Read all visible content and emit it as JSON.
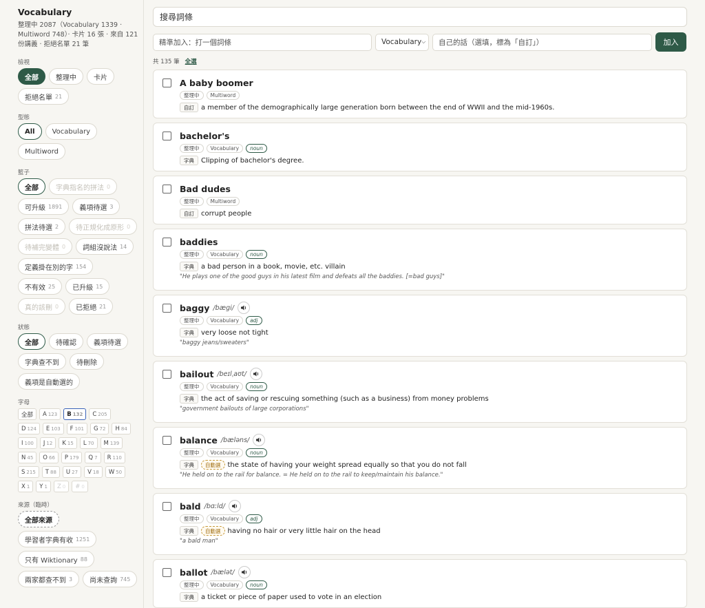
{
  "sidebar": {
    "title": "Vocabulary",
    "summary": "整理中 2087（Vocabulary 1339 · Multiword 748）· 卡片 16 張 · 來自 121 份講義 · 拒絕名單 21 筆",
    "view": {
      "label": "檢視",
      "options": [
        {
          "label": "全部",
          "count": "",
          "state": "active"
        },
        {
          "label": "整理中",
          "count": "",
          "state": ""
        },
        {
          "label": "卡片",
          "count": "",
          "state": ""
        },
        {
          "label": "拒絕名單",
          "count": "21",
          "state": ""
        }
      ]
    },
    "type": {
      "label": "型態",
      "options": [
        {
          "label": "All",
          "count": "",
          "state": "outline-active"
        },
        {
          "label": "Vocabulary",
          "count": "",
          "state": ""
        },
        {
          "label": "Multiword",
          "count": "",
          "state": ""
        }
      ]
    },
    "basket": {
      "label": "籃子",
      "options": [
        {
          "label": "全部",
          "count": "",
          "state": "outline-active"
        },
        {
          "label": "字典指名的拼法",
          "count": "0",
          "state": "disabled"
        },
        {
          "label": "可升級",
          "count": "1891",
          "state": ""
        },
        {
          "label": "義項待選",
          "count": "3",
          "state": ""
        },
        {
          "label": "拼法待選",
          "count": "2",
          "state": ""
        },
        {
          "label": "待正規化成原形",
          "count": "0",
          "state": "disabled"
        },
        {
          "label": "待補完變體",
          "count": "0",
          "state": "disabled"
        },
        {
          "label": "詞組沒說法",
          "count": "14",
          "state": ""
        },
        {
          "label": "定義掛在別的字",
          "count": "154",
          "state": ""
        },
        {
          "label": "不有效",
          "count": "25",
          "state": ""
        },
        {
          "label": "已升級",
          "count": "15",
          "state": ""
        },
        {
          "label": "真的該刪",
          "count": "0",
          "state": "disabled"
        },
        {
          "label": "已拒絕",
          "count": "21",
          "state": ""
        }
      ]
    },
    "status": {
      "label": "狀態",
      "options": [
        {
          "label": "全部",
          "count": "",
          "state": "outline-active"
        },
        {
          "label": "待確認",
          "count": "",
          "state": ""
        },
        {
          "label": "義項待選",
          "count": "",
          "state": ""
        },
        {
          "label": "字典查不到",
          "count": "",
          "state": ""
        },
        {
          "label": "待刪除",
          "count": "",
          "state": ""
        },
        {
          "label": "義項是自動選的",
          "count": "",
          "state": ""
        }
      ]
    },
    "letters": {
      "label": "字母",
      "options": [
        {
          "label": "全部",
          "count": "",
          "state": ""
        },
        {
          "label": "A",
          "count": "123",
          "state": ""
        },
        {
          "label": "B",
          "count": "132",
          "state": "active"
        },
        {
          "label": "C",
          "count": "205",
          "state": ""
        },
        {
          "label": "D",
          "count": "124",
          "state": ""
        },
        {
          "label": "E",
          "count": "103",
          "state": ""
        },
        {
          "label": "F",
          "count": "101",
          "state": ""
        },
        {
          "label": "G",
          "count": "72",
          "state": ""
        },
        {
          "label": "H",
          "count": "84",
          "state": ""
        },
        {
          "label": "I",
          "count": "100",
          "state": ""
        },
        {
          "label": "J",
          "count": "12",
          "state": ""
        },
        {
          "label": "K",
          "count": "15",
          "state": ""
        },
        {
          "label": "L",
          "count": "70",
          "state": ""
        },
        {
          "label": "M",
          "count": "139",
          "state": ""
        },
        {
          "label": "N",
          "count": "45",
          "state": ""
        },
        {
          "label": "O",
          "count": "66",
          "state": ""
        },
        {
          "label": "P",
          "count": "179",
          "state": ""
        },
        {
          "label": "Q",
          "count": "7",
          "state": ""
        },
        {
          "label": "R",
          "count": "110",
          "state": ""
        },
        {
          "label": "S",
          "count": "215",
          "state": ""
        },
        {
          "label": "T",
          "count": "88",
          "state": ""
        },
        {
          "label": "U",
          "count": "27",
          "state": ""
        },
        {
          "label": "V",
          "count": "18",
          "state": ""
        },
        {
          "label": "W",
          "count": "50",
          "state": ""
        },
        {
          "label": "X",
          "count": "1",
          "state": ""
        },
        {
          "label": "Y",
          "count": "1",
          "state": ""
        },
        {
          "label": "Z",
          "count": "0",
          "state": "disabled"
        },
        {
          "label": "#",
          "count": "0",
          "state": "disabled"
        }
      ]
    },
    "source": {
      "label": "來源（臨時）",
      "options": [
        {
          "label": "全部來源",
          "count": "",
          "state": "dashed"
        },
        {
          "label": "學習者字典有收",
          "count": "1251",
          "state": ""
        },
        {
          "label": "只有 Wiktionary",
          "count": "88",
          "state": ""
        },
        {
          "label": "兩家都查不到",
          "count": "3",
          "state": ""
        },
        {
          "label": "尚未查詢",
          "count": "745",
          "state": ""
        }
      ]
    }
  },
  "main": {
    "search_placeholder": "搜尋詞條",
    "add_input_placeholder": "精準加入：打一個詞條",
    "type_select": "Vocabulary",
    "own_words_placeholder": "自己的話（選填，標為「自訂」）",
    "add_button": "加入",
    "count_text": "共 135 筆",
    "select_all": "全選",
    "entries": [
      {
        "word": "A baby boomer",
        "ipa": "",
        "audio": false,
        "status": "整理中",
        "type": "Multiword",
        "pos": "",
        "source": "自訂",
        "auto": "",
        "definition": "a member of the demographically large generation born between the end of WWII and the mid-1960s.",
        "example": ""
      },
      {
        "word": "bachelor's",
        "ipa": "",
        "audio": false,
        "status": "整理中",
        "type": "Vocabulary",
        "pos": "noun",
        "source": "字典",
        "auto": "",
        "definition": "Clipping of bachelor's degree.",
        "example": ""
      },
      {
        "word": "Bad dudes",
        "ipa": "",
        "audio": false,
        "status": "整理中",
        "type": "Multiword",
        "pos": "",
        "source": "自訂",
        "auto": "",
        "definition": "corrupt people",
        "example": ""
      },
      {
        "word": "baddies",
        "ipa": "",
        "audio": false,
        "status": "整理中",
        "type": "Vocabulary",
        "pos": "noun",
        "source": "字典",
        "auto": "",
        "definition": "a bad person in a book, movie, etc. villain",
        "example": "\"He plays one of the good guys in his latest film and defeats all the baddies. [=bad guys]\""
      },
      {
        "word": "baggy",
        "ipa": "/bægi/",
        "audio": true,
        "status": "整理中",
        "type": "Vocabulary",
        "pos": "adj",
        "source": "字典",
        "auto": "",
        "definition": "very loose not tight",
        "example": "\"baggy jeans/sweaters\""
      },
      {
        "word": "bailout",
        "ipa": "/beɪlˌaʊt/",
        "audio": true,
        "status": "整理中",
        "type": "Vocabulary",
        "pos": "noun",
        "source": "字典",
        "auto": "",
        "definition": "the act of saving or rescuing something (such as a business) from money problems",
        "example": "\"government bailouts of large corporations\""
      },
      {
        "word": "balance",
        "ipa": "/bæləns/",
        "audio": true,
        "status": "整理中",
        "type": "Vocabulary",
        "pos": "noun",
        "source": "字典",
        "auto": "自動選",
        "definition": "the state of having your weight spread equally so that you do not fall",
        "example": "\"He held on to the rail for balance. = He held on to the rail to keep/maintain his balance.\""
      },
      {
        "word": "bald",
        "ipa": "/bɑːld/",
        "audio": true,
        "status": "整理中",
        "type": "Vocabulary",
        "pos": "adj",
        "source": "字典",
        "auto": "自動選",
        "definition": "having no hair or very little hair on the head",
        "example": "\"a bald man\""
      },
      {
        "word": "ballot",
        "ipa": "/bælət/",
        "audio": true,
        "status": "整理中",
        "type": "Vocabulary",
        "pos": "noun",
        "source": "字典",
        "auto": "",
        "definition": "a ticket or piece of paper used to vote in an election",
        "example": ""
      }
    ]
  },
  "colors": {
    "accent": "#2e5a47",
    "letter_active": "#3a63b8",
    "auto_border": "#c79a3a"
  },
  "icons": {
    "speaker": "speaker-icon",
    "dropdown": "chevron-down-icon"
  }
}
